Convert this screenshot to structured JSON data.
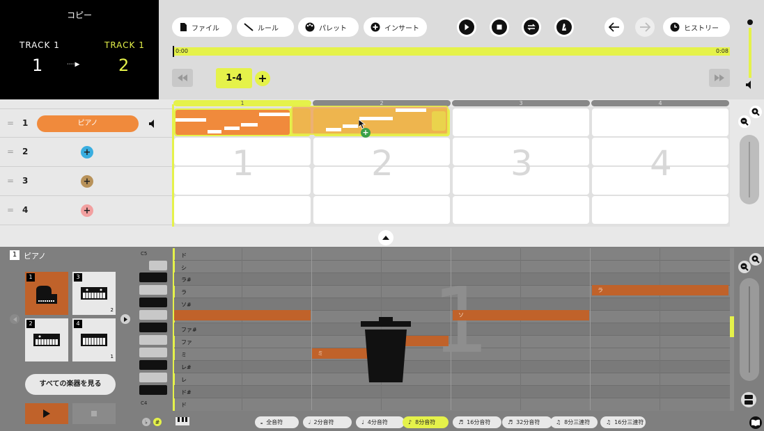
{
  "copy_panel": {
    "title": "コピー",
    "from_label": "TRACK 1",
    "to_label": "TRACK 1",
    "from_num": "1",
    "to_num": "2",
    "arrow": "····▶"
  },
  "toolbar": {
    "file": "ファイル",
    "rule": "ルール",
    "palette": "パレット",
    "insert": "インサート",
    "history": "ヒストリー",
    "time_start": "0:00",
    "time_end": "0:08",
    "range": "1-4",
    "add": "+"
  },
  "bars": [
    "1",
    "2",
    "3",
    "4"
  ],
  "tracks": [
    {
      "num": "1",
      "instrument": "ピアノ",
      "color": "#f08a3c"
    },
    {
      "num": "2",
      "add": "+",
      "color": "#3aaee0"
    },
    {
      "num": "3",
      "add": "+",
      "color": "#b8925a"
    },
    {
      "num": "4",
      "add": "+",
      "color": "#f2a0a0"
    }
  ],
  "grid_numbers": [
    "1",
    "2",
    "3",
    "4"
  ],
  "editor": {
    "track_num": "1",
    "instrument": "ピアノ",
    "see_all": "すべての楽器を見る",
    "cards": [
      {
        "num": "1"
      },
      {
        "num": "3",
        "badge": "2"
      },
      {
        "num": "2"
      },
      {
        "num": "4",
        "badge": "1"
      }
    ],
    "octave_top": "C5",
    "octave_bottom": "C4",
    "flat": "♭",
    "sharp": "#",
    "notes": [
      "ド",
      "シ",
      "ラ#",
      "ラ",
      "ソ#",
      "ソ",
      "ファ#",
      "ファ",
      "ミ",
      "レ#",
      "レ",
      "ド#",
      "ド"
    ],
    "note_blocks": {
      "la": "ラ",
      "so": "ソ",
      "mi": "ミ"
    },
    "watermark": "1"
  },
  "durations": [
    "全音符",
    "2分音符",
    "4分音符",
    "8分音符",
    "16分音符",
    "32分音符",
    "8分三連符",
    "16分三連符"
  ],
  "selected_duration": "8分音符",
  "colors": {
    "accent": "#e5f24a",
    "orange": "#f08a3c",
    "note": "#c0622a"
  }
}
